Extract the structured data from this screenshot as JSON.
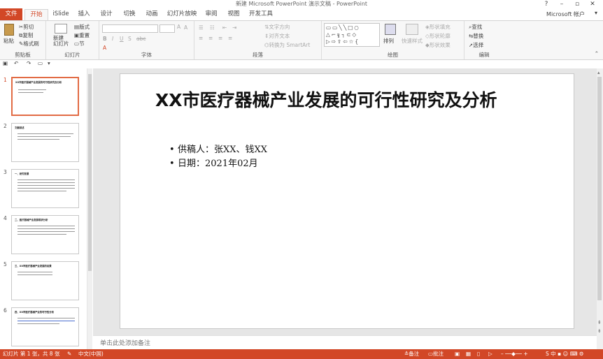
{
  "window": {
    "title": "新建 Microsoft PowerPoint 演示文稿 - PowerPoint"
  },
  "tabs": [
    "文件",
    "开始",
    "iSlide",
    "插入",
    "设计",
    "切换",
    "动画",
    "幻灯片放映",
    "审阅",
    "视图",
    "开发工具"
  ],
  "account": "Microsoft 帐户",
  "ribbon": {
    "clipboard": {
      "paste": "粘贴",
      "cut": "剪切",
      "copy": "复制",
      "format": "格式刷",
      "label": "剪贴板"
    },
    "slides": {
      "new_slide": "新建\n幻灯片",
      "layout": "版式",
      "reset": "重置",
      "section": "节",
      "label": "幻灯片"
    },
    "font": {
      "label": "字体"
    },
    "paragraph": {
      "text_direction": "文字方向",
      "align_text": "对齐文本",
      "smartart": "转换为 SmartArt",
      "label": "段落"
    },
    "drawing": {
      "arrange": "排列",
      "quick_styles": "快速样式",
      "shape_fill": "形状填充",
      "shape_outline": "形状轮廓",
      "shape_effects": "形状效果",
      "label": "绘图"
    },
    "editing": {
      "find": "查找",
      "replace": "替换",
      "select": "选择",
      "label": "编辑"
    }
  },
  "thumbnails": [
    {
      "num": "1",
      "title": "XX市医疗器械产业发展的可行性研究及分析",
      "selected": true
    },
    {
      "num": "2",
      "title": "文献综述",
      "selected": false
    },
    {
      "num": "3",
      "title": "一、研究背景",
      "selected": false
    },
    {
      "num": "4",
      "title": "二、医疗器械产业发展现状分析",
      "selected": false
    },
    {
      "num": "5",
      "title": "三、XX市医疗器械产业发展的前景",
      "selected": false
    },
    {
      "num": "6",
      "title": "四、XX市医疗器械产业的可行性分析",
      "selected": false
    }
  ],
  "slide": {
    "title": "XX市医疗器械产业发展的可行性研究及分析",
    "bullets": [
      "供稿人：张XX、钱XX",
      "日期：2021年02月"
    ]
  },
  "notes_placeholder": "单击此处添加备注",
  "status": {
    "slide_info": "幻灯片 第 1 张，共 8 张",
    "lang": "中文(中国)",
    "notes": "备注",
    "comments": "批注"
  },
  "colors": {
    "accent": "#D24726",
    "tab_bg": "#F7F7F7"
  }
}
